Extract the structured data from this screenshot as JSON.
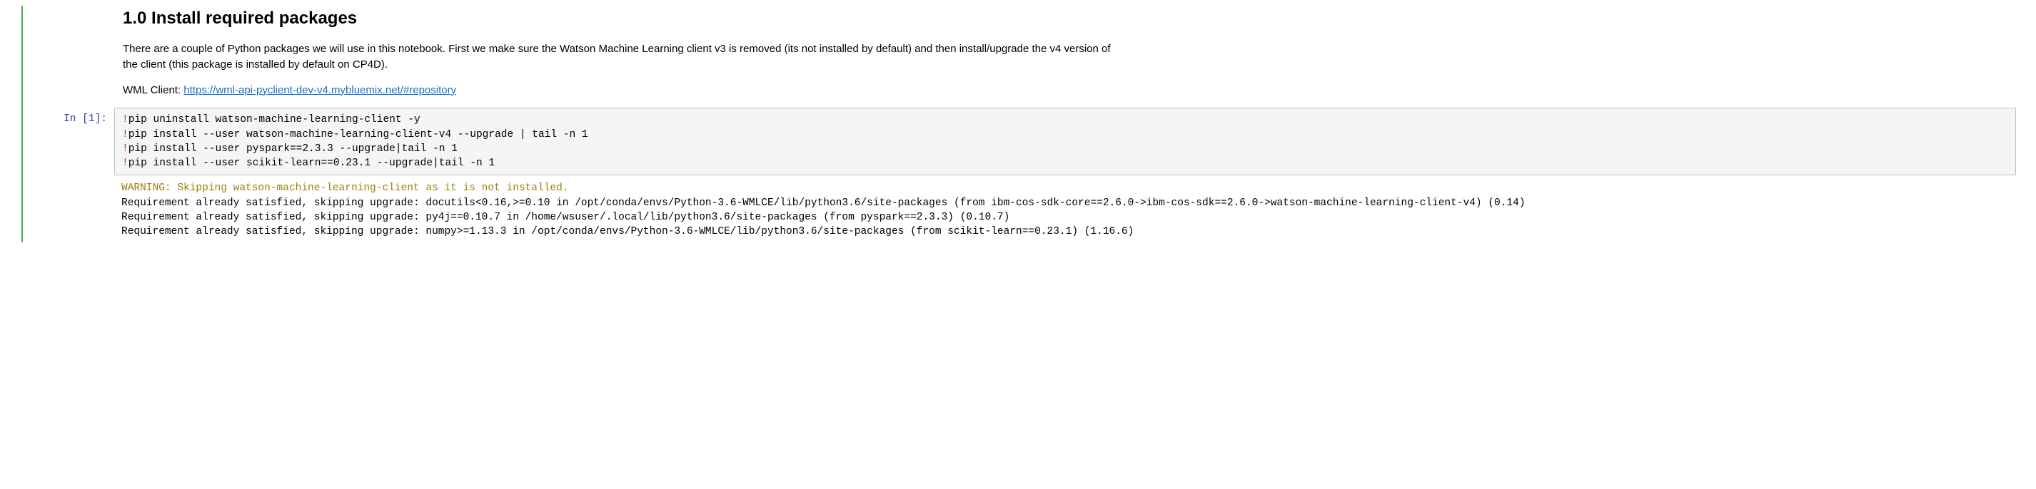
{
  "text_cell": {
    "heading": "1.0 Install required packages",
    "para1": "There are a couple of Python packages we will use in this notebook. First we make sure the Watson Machine Learning client v3 is removed (its not installed by default) and then install/upgrade the v4 version of the client (this package is installed by default on CP4D).",
    "para2_prefix": "WML Client: ",
    "link_text": "https://wml-api-pyclient-dev-v4.mybluemix.net/#repository",
    "link_href": "https://wml-api-pyclient-dev-v4.mybluemix.net/#repository"
  },
  "code_cell": {
    "prompt": "In [1]:",
    "lines": {
      "l1_bang": "!",
      "l1_rest": "pip uninstall watson-machine-learning-client -y",
      "l2_bang": "!",
      "l2_rest": "pip install --user watson-machine-learning-client-v4 --upgrade | tail -n 1",
      "l3_bang": "!",
      "l3_rest": "pip install --user pyspark==2.3.3 --upgrade|tail -n 1",
      "l4_bang": "!",
      "l4_rest": "pip install --user scikit-learn==0.23.1 --upgrade|tail -n 1"
    },
    "output": {
      "warn": "WARNING: Skipping watson-machine-learning-client as it is not installed.",
      "o2": "Requirement already satisfied, skipping upgrade: docutils<0.16,>=0.10 in /opt/conda/envs/Python-3.6-WMLCE/lib/python3.6/site-packages (from ibm-cos-sdk-core==2.6.0->ibm-cos-sdk==2.6.0->watson-machine-learning-client-v4) (0.14)",
      "o3": "Requirement already satisfied, skipping upgrade: py4j==0.10.7 in /home/wsuser/.local/lib/python3.6/site-packages (from pyspark==2.3.3) (0.10.7)",
      "o4": "Requirement already satisfied, skipping upgrade: numpy>=1.13.3 in /opt/conda/envs/Python-3.6-WMLCE/lib/python3.6/site-packages (from scikit-learn==0.23.1) (1.16.6)"
    }
  }
}
